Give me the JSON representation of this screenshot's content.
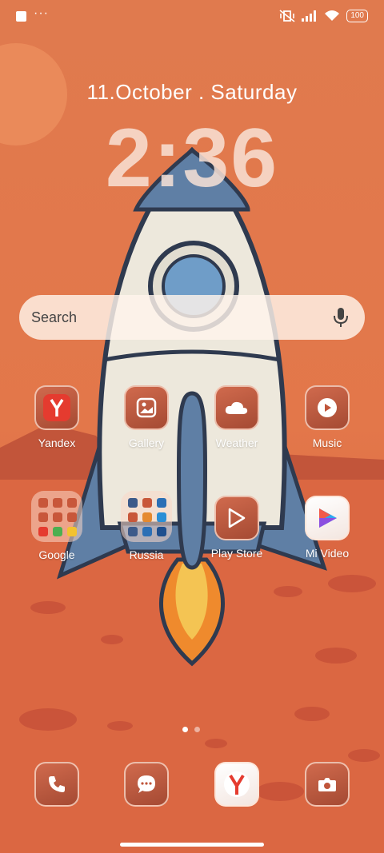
{
  "status_bar": {
    "left_more": "···",
    "battery": "100"
  },
  "lockscreen": {
    "date": "11.October . Saturday",
    "time": "2:36"
  },
  "search": {
    "placeholder": "Search",
    "icon": "mic-icon"
  },
  "apps": [
    {
      "label": "Yandex"
    },
    {
      "label": "Gallery"
    },
    {
      "label": "Weather"
    },
    {
      "label": "Music"
    },
    {
      "label": "Google"
    },
    {
      "label": "Russia"
    },
    {
      "label": "Play Store"
    },
    {
      "label": "Mi Video"
    }
  ],
  "dock": [
    "phone-icon",
    "messages-icon",
    "yandex-browser-icon",
    "camera-icon"
  ],
  "colors": {
    "background": "#d9663f",
    "accent": "#e53b2f"
  },
  "pager": {
    "pages": 2,
    "active": 1
  }
}
